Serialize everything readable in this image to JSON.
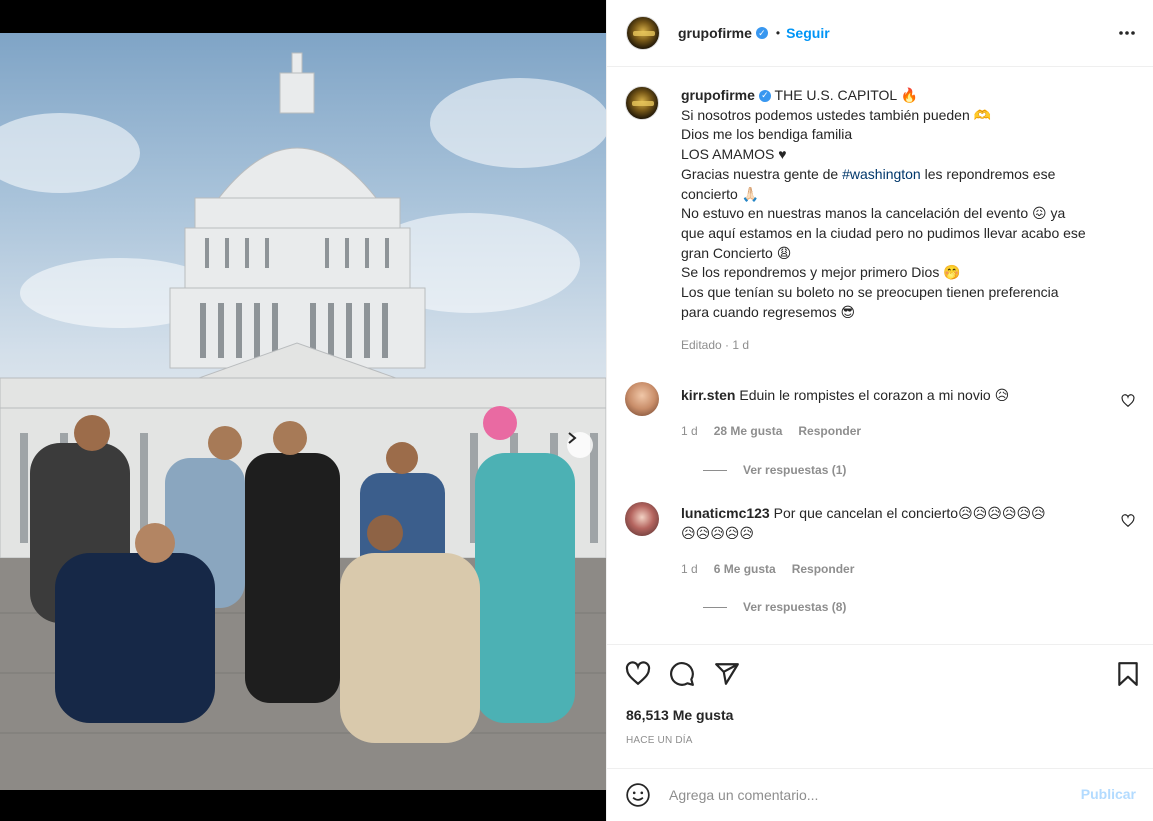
{
  "post": {
    "username": "grupofirme",
    "verified_icon": "verified-badge-icon",
    "separator": "•",
    "follow_label": "Seguir",
    "photo_dots": 10,
    "photo_active_dot": 0
  },
  "caption": {
    "username": "grupofirme",
    "lines": [
      "THE U.S. CAPITOL 🔥",
      "Si nosotros podemos ustedes también pueden 🫶",
      "Dios me los bendiga familia",
      "LOS AMAMOS ♥",
      "Gracias nuestra gente de",
      "#washington",
      "les repondremos ese",
      "concierto 🙏🏻",
      "No estuvo en nuestras manos la cancelación del evento 😖 ya",
      "que aquí estamos en la ciudad pero no pudimos llevar acabo ese",
      "gran Concierto 😩",
      "Se los repondremos y mejor primero Dios 🤭",
      "Los que tenían su boleto no se preocupen tienen preferencia",
      "para cuando regresemos 😎"
    ],
    "meta": "Editado · 1 d"
  },
  "comments": [
    {
      "username": "kirr.sten",
      "text": "Eduin le rompistes el corazon a mi novio 😥",
      "time": "1 d",
      "likes": "28 Me gusta",
      "reply_label": "Responder",
      "view_replies": "Ver respuestas (1)"
    },
    {
      "username": "lunaticmc123",
      "text": "Por que cancelan el concierto",
      "emoji_row_1": "😥😥😥😥😥😥",
      "emoji_row_2": "😥😥😥😥😥",
      "time": "1 d",
      "likes": "6 Me gusta",
      "reply_label": "Responder",
      "view_replies": "Ver respuestas (8)"
    }
  ],
  "actions": {
    "likes": "86,513 Me gusta",
    "time": "HACE UN DÍA",
    "icons": [
      "heart-icon",
      "comment-icon",
      "share-icon",
      "save-icon"
    ]
  },
  "composer": {
    "placeholder": "Agrega un comentario...",
    "publish_label": "Publicar",
    "emoji_icon": "emoji-icon"
  },
  "colors": {
    "link": "#0095f6",
    "hashtag": "#00376b",
    "muted": "#8e8e8e",
    "publish_disabled": "#b3dbff"
  }
}
